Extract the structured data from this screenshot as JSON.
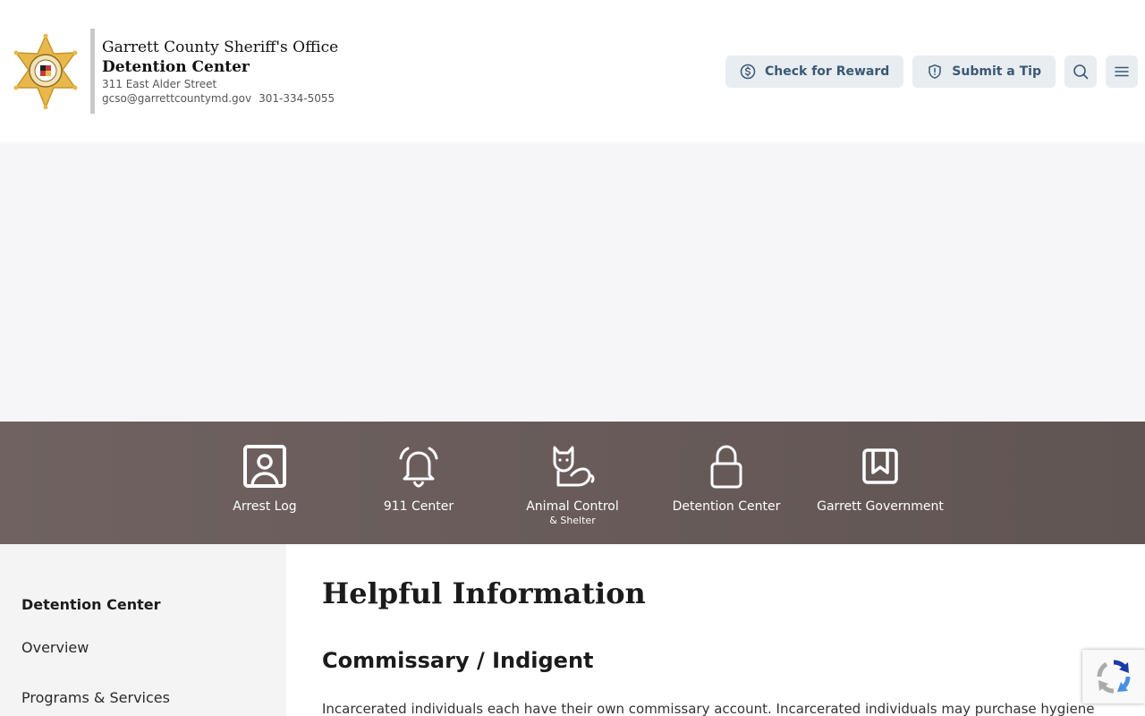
{
  "header": {
    "org_name": "Garrett County Sheriff's Office",
    "department": "Detention Center",
    "address": "311 East Alder Street",
    "email": "gcso@garrettcountymd.gov",
    "phone": "301-334-5055"
  },
  "actions": {
    "reward_label": "Check for Reward",
    "tip_label": "Submit a Tip",
    "search_icon": "search-icon",
    "menu_icon": "menu-icon"
  },
  "quick_links": [
    {
      "label": "Arrest Log",
      "sub": "",
      "icon": "id-card-icon"
    },
    {
      "label": "911 Center",
      "sub": "",
      "icon": "bell-icon"
    },
    {
      "label": "Animal Control",
      "sub": "& Shelter",
      "icon": "cat-icon"
    },
    {
      "label": "Detention Center",
      "sub": "",
      "icon": "lock-icon"
    },
    {
      "label": "Garrett Government",
      "sub": "",
      "icon": "bookmark-book-icon"
    }
  ],
  "sidebar": {
    "title": "Detention Center",
    "items": [
      {
        "label": "Overview"
      },
      {
        "label": "Programs & Services"
      }
    ]
  },
  "main": {
    "title": "Helpful Information",
    "section_title": "Commissary / Indigent",
    "paragraph": "Incarcerated individuals each have their own commissary account. Incarcerated individuals may purchase hygiene"
  },
  "colors": {
    "band": "#685b59",
    "pill_bg": "#e8edf2",
    "pill_text": "#3b5873",
    "star_gold": "#e8b94a"
  }
}
